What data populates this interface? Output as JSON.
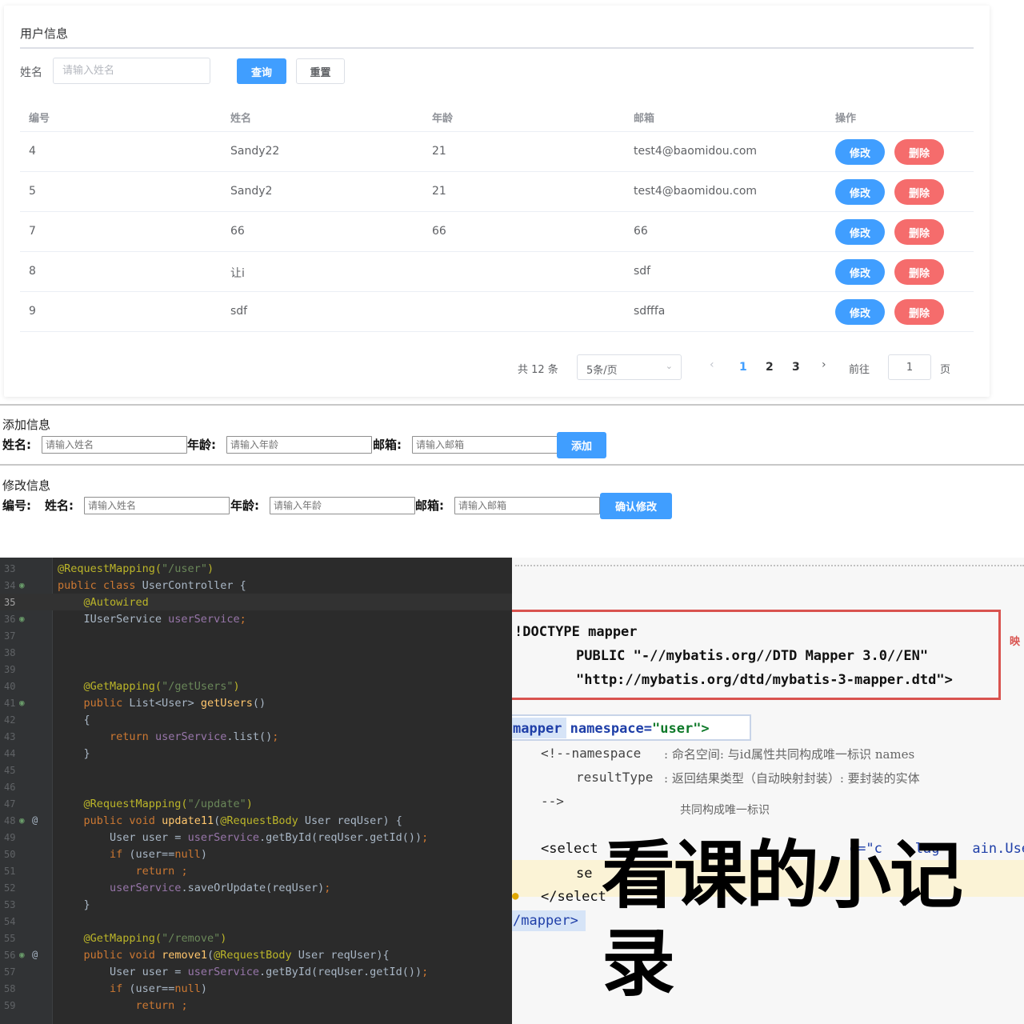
{
  "card": {
    "title": "用户信息",
    "search_label": "姓名",
    "search_placeholder": "请输入姓名",
    "query_button": "查询",
    "reset_button": "重置"
  },
  "table": {
    "headers": [
      "编号",
      "姓名",
      "年龄",
      "邮箱",
      "操作"
    ],
    "rows": [
      {
        "id": "4",
        "name": "Sandy22",
        "age": "21",
        "email": "test4@baomidou.com"
      },
      {
        "id": "5",
        "name": "Sandy2",
        "age": "21",
        "email": "test4@baomidou.com"
      },
      {
        "id": "7",
        "name": "66",
        "age": "66",
        "email": "66"
      },
      {
        "id": "8",
        "name": "让i",
        "age": "",
        "email": "sdf"
      },
      {
        "id": "9",
        "name": "sdf",
        "age": "",
        "email": "sdfffa"
      }
    ],
    "edit_label": "修改",
    "delete_label": "删除"
  },
  "pagination": {
    "total": "共 12 条",
    "page_size": "5条/页",
    "prev": "‹",
    "pages": [
      "1",
      "2",
      "3"
    ],
    "current_page": "1",
    "next": "›",
    "goto_label": "前往",
    "jump_value": "1",
    "page_suffix": "页"
  },
  "add_form": {
    "title": "添加信息",
    "name_label": "姓名:",
    "name_placeholder": "请输入姓名",
    "age_label": "年龄:",
    "age_placeholder": "请输入年龄",
    "email_label": "邮箱:",
    "email_placeholder": "请输入邮箱",
    "submit": "添加"
  },
  "edit_form": {
    "title": "修改信息",
    "id_label": "编号:",
    "name_label": "姓名:",
    "name_placeholder": "请输入姓名",
    "age_label": "年龄:",
    "age_placeholder": "请输入年龄",
    "email_label": "邮箱:",
    "email_placeholder": "请输入邮箱",
    "submit": "确认修改"
  },
  "code": {
    "current_line": "35",
    "lines": [
      {
        "n": "33",
        "t": [
          [
            "a",
            "@RequestMapping("
          ],
          [
            "s",
            "\"/user\""
          ],
          [
            "a",
            ")"
          ]
        ]
      },
      {
        "n": "34",
        "icon": "bean",
        "t": [
          [
            "k",
            "public class "
          ],
          [
            "p",
            "UserController {"
          ]
        ]
      },
      {
        "n": "35",
        "t": [
          [
            "p",
            "    "
          ],
          [
            "a",
            "@Autowired"
          ]
        ]
      },
      {
        "n": "36",
        "icon": "bean",
        "t": [
          [
            "p",
            "    IUserService "
          ],
          [
            "f",
            "userService"
          ],
          [
            "k",
            ";"
          ]
        ]
      },
      {
        "n": "37",
        "t": []
      },
      {
        "n": "38",
        "t": []
      },
      {
        "n": "39",
        "t": []
      },
      {
        "n": "40",
        "t": [
          [
            "p",
            "    "
          ],
          [
            "a",
            "@GetMapping("
          ],
          [
            "s",
            "\"/getUsers\""
          ],
          [
            "a",
            ")"
          ]
        ]
      },
      {
        "n": "41",
        "icon": "bean",
        "t": [
          [
            "p",
            "    "
          ],
          [
            "k",
            "public "
          ],
          [
            "p",
            "List<User> "
          ],
          [
            "m",
            "getUsers"
          ],
          [
            "p",
            "()"
          ]
        ]
      },
      {
        "n": "42",
        "t": [
          [
            "p",
            "    {"
          ]
        ]
      },
      {
        "n": "43",
        "t": [
          [
            "p",
            "        "
          ],
          [
            "k",
            "return "
          ],
          [
            "f",
            "userService"
          ],
          [
            "p",
            ".list()"
          ],
          [
            "k",
            ";"
          ]
        ]
      },
      {
        "n": "44",
        "t": [
          [
            "p",
            "    }"
          ]
        ]
      },
      {
        "n": "45",
        "t": []
      },
      {
        "n": "46",
        "t": []
      },
      {
        "n": "47",
        "t": [
          [
            "p",
            "    "
          ],
          [
            "a",
            "@RequestMapping("
          ],
          [
            "s",
            "\"/update\""
          ],
          [
            "a",
            ")"
          ]
        ]
      },
      {
        "n": "48",
        "icon": "bean-web",
        "t": [
          [
            "p",
            "    "
          ],
          [
            "k",
            "public void "
          ],
          [
            "m",
            "update11"
          ],
          [
            "p",
            "("
          ],
          [
            "a",
            "@RequestBody "
          ],
          [
            "p",
            "User reqUser) {"
          ]
        ]
      },
      {
        "n": "49",
        "t": [
          [
            "p",
            "        User user = "
          ],
          [
            "f",
            "userService"
          ],
          [
            "p",
            ".getById(reqUser.getId())"
          ],
          [
            "k",
            ";"
          ]
        ]
      },
      {
        "n": "50",
        "t": [
          [
            "p",
            "        "
          ],
          [
            "k",
            "if "
          ],
          [
            "p",
            "(user=="
          ],
          [
            "k",
            "null"
          ],
          [
            "p",
            ")"
          ]
        ]
      },
      {
        "n": "51",
        "t": [
          [
            "p",
            "            "
          ],
          [
            "k",
            "return ;"
          ]
        ]
      },
      {
        "n": "52",
        "t": [
          [
            "p",
            "        "
          ],
          [
            "f",
            "userService"
          ],
          [
            "p",
            ".saveOrUpdate(reqUser)"
          ],
          [
            "k",
            ";"
          ]
        ]
      },
      {
        "n": "53",
        "t": [
          [
            "p",
            "    }"
          ]
        ]
      },
      {
        "n": "54",
        "t": []
      },
      {
        "n": "55",
        "t": [
          [
            "p",
            "    "
          ],
          [
            "a",
            "@GetMapping("
          ],
          [
            "s",
            "\"/remove\""
          ],
          [
            "a",
            ")"
          ]
        ]
      },
      {
        "n": "56",
        "icon": "bean-web",
        "t": [
          [
            "p",
            "    "
          ],
          [
            "k",
            "public void "
          ],
          [
            "m",
            "remove1"
          ],
          [
            "p",
            "("
          ],
          [
            "a",
            "@RequestBody "
          ],
          [
            "p",
            "User reqUser){"
          ]
        ]
      },
      {
        "n": "57",
        "t": [
          [
            "p",
            "        User user = "
          ],
          [
            "f",
            "userService"
          ],
          [
            "p",
            ".getById(reqUser.getId())"
          ],
          [
            "k",
            ";"
          ]
        ]
      },
      {
        "n": "58",
        "t": [
          [
            "p",
            "        "
          ],
          [
            "k",
            "if "
          ],
          [
            "p",
            "(user=="
          ],
          [
            "k",
            "null"
          ],
          [
            "p",
            ")"
          ]
        ]
      },
      {
        "n": "59",
        "t": [
          [
            "p",
            "            "
          ],
          [
            "k",
            "return ;"
          ]
        ]
      }
    ]
  },
  "xml": {
    "doctype_1": "!DOCTYPE mapper",
    "doctype_2": "PUBLIC \"-//mybatis.org//DTD Mapper 3.0//EN\"",
    "doctype_3": "\"http://mybatis.org/dtd/mybatis-3-mapper.dtd\">",
    "side_mark": "映",
    "mapper_open_tag": "mapper",
    "mapper_open_attr": " namespace=",
    "mapper_open_val": "\"user\">",
    "comment_1": "<!--namespace",
    "comment_1_note": ": 命名空间: 与id属性共同构成唯一标识 names",
    "comment_2": "resultType",
    "comment_2_note": ": 返回结果类型（自动映射封装）: 要封装的实体",
    "comment_3": "-->",
    "comment_3_note": "共同构成唯一标识",
    "select_open": "<select",
    "select_attr": "        e=\"c    lag    ain.Use",
    "select_body": "se",
    "select_close": "</select",
    "mapper_close": "/mapper>",
    "watermark": "看课的小记录"
  },
  "colors": {
    "primary": "#409eff",
    "danger": "#f56c6c",
    "editor_bg": "#2b2b2b",
    "xml_box": "#d9534f"
  }
}
